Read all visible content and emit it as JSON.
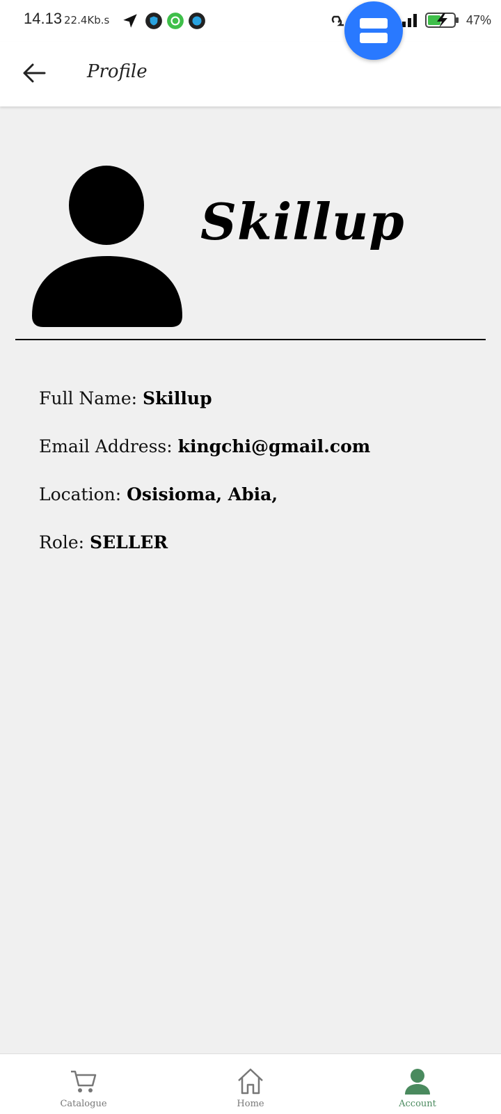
{
  "status_bar": {
    "time": "14.13",
    "speed": "22.4Kb.s",
    "battery": "47%"
  },
  "header": {
    "title": "Profile"
  },
  "profile": {
    "name": "Skillup"
  },
  "details": {
    "full_name_label": "Full Name:",
    "full_name_value": "Skillup",
    "email_label": "Email Address:",
    "email_value": "kingchi@gmail.com",
    "location_label": "Location:",
    "location_value": "Osisioma, Abia,",
    "role_label": "Role:",
    "role_value": "SELLER"
  },
  "bottom_nav": {
    "items": [
      {
        "label": "Catalogue",
        "icon": "cart-icon"
      },
      {
        "label": "Home",
        "icon": "home-icon"
      },
      {
        "label": "Account",
        "icon": "account-icon",
        "active": true
      }
    ]
  },
  "colors": {
    "accent": "#4a8a5e",
    "fab": "#2979ff",
    "background": "#f0f0f0"
  }
}
